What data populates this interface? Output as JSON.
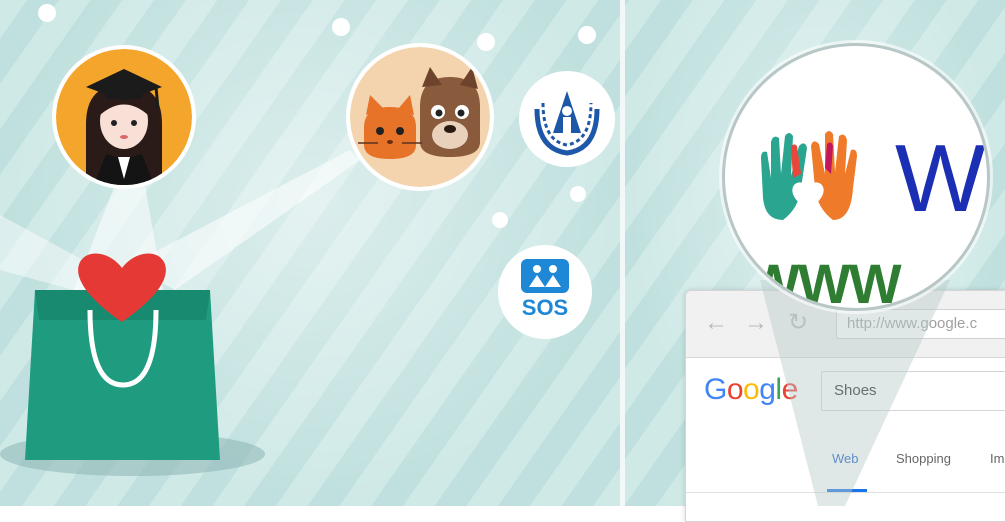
{
  "colors": {
    "background_stripe_light": "#cfe9e7",
    "background_stripe_dark": "#bfe0de",
    "bag": "#1f9c7f",
    "heart": "#e53935",
    "graduate_circle": "#f4a52b",
    "pets_circle": "#f3d4ae",
    "sos_blue": "#1e88d6",
    "un_blue": "#1d57a8",
    "magnifier_w": "#1b2fb5",
    "magnifier_www": "#2e7d32"
  },
  "icons": {
    "graduate": "graduate-avatar-icon",
    "pets": "cat-and-dog-icon",
    "un": "unhcr-emblem-icon",
    "sos": "sos-children-icon",
    "bag": "shopping-bag-icon",
    "heart": "heart-icon",
    "hands": "colorful-hands-heart-icon"
  },
  "sos": {
    "label": "SOS"
  },
  "magnifier": {
    "w": "W",
    "www": "WWW"
  },
  "browser": {
    "back_glyph": "←",
    "forward_glyph": "→",
    "reload_glyph": "↻",
    "url": "http://www.google.c",
    "logo": [
      "G",
      "o",
      "o",
      "g",
      "l",
      "e"
    ],
    "logo_colors": [
      "#4285f4",
      "#ea4335",
      "#fbbc05",
      "#4285f4",
      "#34a853",
      "#ea4335"
    ],
    "search_value": "Shoes",
    "tabs": [
      "Web",
      "Shopping",
      "Im"
    ]
  }
}
